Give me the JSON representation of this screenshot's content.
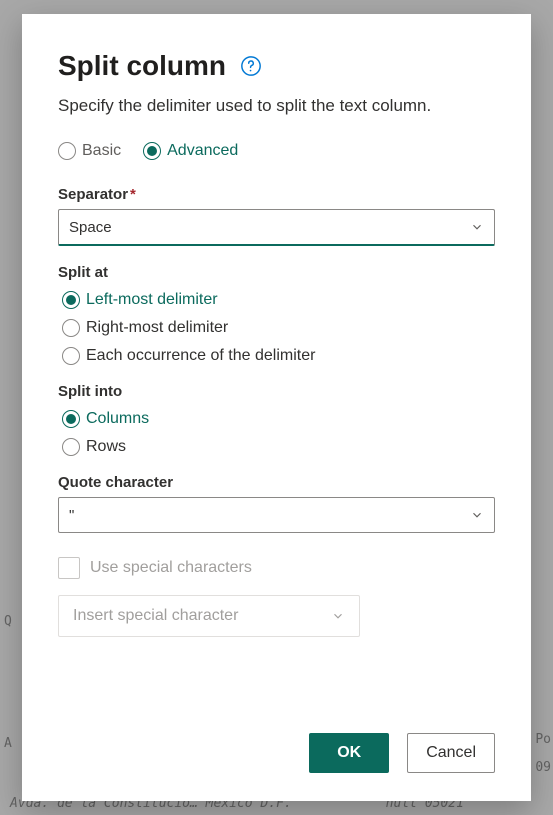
{
  "dialog": {
    "title": "Split column",
    "subtitle": "Specify the delimiter used to split the text column.",
    "mode": {
      "basic": "Basic",
      "advanced": "Advanced"
    },
    "separator": {
      "label": "Separator",
      "value": "Space"
    },
    "split_at": {
      "label": "Split at",
      "options": {
        "left": "Left-most delimiter",
        "right": "Right-most delimiter",
        "each": "Each occurrence of the delimiter"
      }
    },
    "split_into": {
      "label": "Split into",
      "options": {
        "columns": "Columns",
        "rows": "Rows"
      }
    },
    "quote": {
      "label": "Quote character",
      "value": "\""
    },
    "special": {
      "checkbox_label": "Use special characters",
      "insert_label": "Insert special character"
    },
    "buttons": {
      "ok": "OK",
      "cancel": "Cancel"
    }
  },
  "background": {
    "left_q": "Q",
    "left_a": "A",
    "right_po": "Po",
    "right_num": "09",
    "bottom_row": "Avda. de la Constitucio… México D.F.            null 05021"
  }
}
